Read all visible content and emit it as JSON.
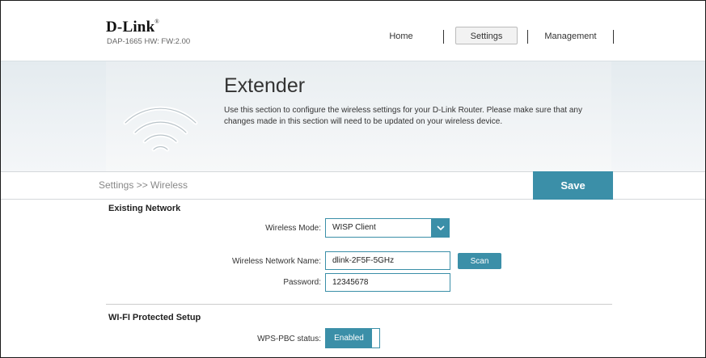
{
  "header": {
    "brand": "D-Link",
    "brand_mark": "®",
    "model_info": "DAP-1665 HW: FW:2.00",
    "nav": [
      {
        "label": "Home"
      },
      {
        "label": "Settings",
        "active": true
      },
      {
        "label": "Management"
      }
    ]
  },
  "banner": {
    "icon": "wifi-icon",
    "title": "Extender",
    "description": "Use this section to configure the wireless settings for your D-Link Router. Please make sure that any changes made in this section will need to be updated on your wireless device."
  },
  "toolbar": {
    "breadcrumb": "Settings >> Wireless",
    "save_label": "Save"
  },
  "existing_network": {
    "title": "Existing Network",
    "wireless_mode_label": "Wireless Mode:",
    "wireless_mode_value": "WISP Client",
    "network_name_label": "Wireless Network Name:",
    "network_name_value": "dlink-2F5F-5GHz",
    "scan_label": "Scan",
    "password_label": "Password:",
    "password_value": "12345678"
  },
  "wps": {
    "title": "WI-FI Protected Setup",
    "status_label": "WPS-PBC status:",
    "status_value": "Enabled"
  },
  "colors": {
    "accent": "#3b8fa8"
  }
}
